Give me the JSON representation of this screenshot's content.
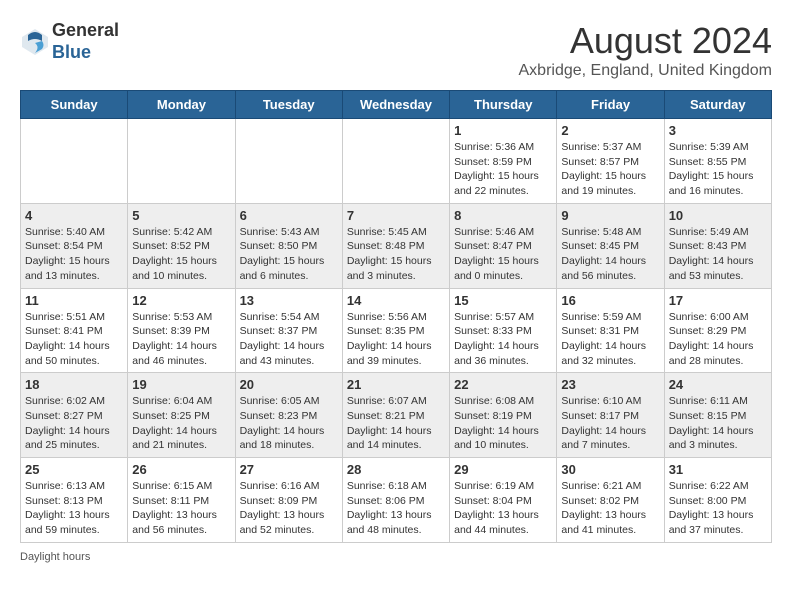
{
  "header": {
    "logo_line1": "General",
    "logo_line2": "Blue",
    "month_year": "August 2024",
    "location": "Axbridge, England, United Kingdom"
  },
  "days_of_week": [
    "Sunday",
    "Monday",
    "Tuesday",
    "Wednesday",
    "Thursday",
    "Friday",
    "Saturday"
  ],
  "weeks": [
    {
      "days": [
        {
          "num": "",
          "info": ""
        },
        {
          "num": "",
          "info": ""
        },
        {
          "num": "",
          "info": ""
        },
        {
          "num": "",
          "info": ""
        },
        {
          "num": "1",
          "info": "Sunrise: 5:36 AM\nSunset: 8:59 PM\nDaylight: 15 hours\nand 22 minutes."
        },
        {
          "num": "2",
          "info": "Sunrise: 5:37 AM\nSunset: 8:57 PM\nDaylight: 15 hours\nand 19 minutes."
        },
        {
          "num": "3",
          "info": "Sunrise: 5:39 AM\nSunset: 8:55 PM\nDaylight: 15 hours\nand 16 minutes."
        }
      ]
    },
    {
      "days": [
        {
          "num": "4",
          "info": "Sunrise: 5:40 AM\nSunset: 8:54 PM\nDaylight: 15 hours\nand 13 minutes."
        },
        {
          "num": "5",
          "info": "Sunrise: 5:42 AM\nSunset: 8:52 PM\nDaylight: 15 hours\nand 10 minutes."
        },
        {
          "num": "6",
          "info": "Sunrise: 5:43 AM\nSunset: 8:50 PM\nDaylight: 15 hours\nand 6 minutes."
        },
        {
          "num": "7",
          "info": "Sunrise: 5:45 AM\nSunset: 8:48 PM\nDaylight: 15 hours\nand 3 minutes."
        },
        {
          "num": "8",
          "info": "Sunrise: 5:46 AM\nSunset: 8:47 PM\nDaylight: 15 hours\nand 0 minutes."
        },
        {
          "num": "9",
          "info": "Sunrise: 5:48 AM\nSunset: 8:45 PM\nDaylight: 14 hours\nand 56 minutes."
        },
        {
          "num": "10",
          "info": "Sunrise: 5:49 AM\nSunset: 8:43 PM\nDaylight: 14 hours\nand 53 minutes."
        }
      ]
    },
    {
      "days": [
        {
          "num": "11",
          "info": "Sunrise: 5:51 AM\nSunset: 8:41 PM\nDaylight: 14 hours\nand 50 minutes."
        },
        {
          "num": "12",
          "info": "Sunrise: 5:53 AM\nSunset: 8:39 PM\nDaylight: 14 hours\nand 46 minutes."
        },
        {
          "num": "13",
          "info": "Sunrise: 5:54 AM\nSunset: 8:37 PM\nDaylight: 14 hours\nand 43 minutes."
        },
        {
          "num": "14",
          "info": "Sunrise: 5:56 AM\nSunset: 8:35 PM\nDaylight: 14 hours\nand 39 minutes."
        },
        {
          "num": "15",
          "info": "Sunrise: 5:57 AM\nSunset: 8:33 PM\nDaylight: 14 hours\nand 36 minutes."
        },
        {
          "num": "16",
          "info": "Sunrise: 5:59 AM\nSunset: 8:31 PM\nDaylight: 14 hours\nand 32 minutes."
        },
        {
          "num": "17",
          "info": "Sunrise: 6:00 AM\nSunset: 8:29 PM\nDaylight: 14 hours\nand 28 minutes."
        }
      ]
    },
    {
      "days": [
        {
          "num": "18",
          "info": "Sunrise: 6:02 AM\nSunset: 8:27 PM\nDaylight: 14 hours\nand 25 minutes."
        },
        {
          "num": "19",
          "info": "Sunrise: 6:04 AM\nSunset: 8:25 PM\nDaylight: 14 hours\nand 21 minutes."
        },
        {
          "num": "20",
          "info": "Sunrise: 6:05 AM\nSunset: 8:23 PM\nDaylight: 14 hours\nand 18 minutes."
        },
        {
          "num": "21",
          "info": "Sunrise: 6:07 AM\nSunset: 8:21 PM\nDaylight: 14 hours\nand 14 minutes."
        },
        {
          "num": "22",
          "info": "Sunrise: 6:08 AM\nSunset: 8:19 PM\nDaylight: 14 hours\nand 10 minutes."
        },
        {
          "num": "23",
          "info": "Sunrise: 6:10 AM\nSunset: 8:17 PM\nDaylight: 14 hours\nand 7 minutes."
        },
        {
          "num": "24",
          "info": "Sunrise: 6:11 AM\nSunset: 8:15 PM\nDaylight: 14 hours\nand 3 minutes."
        }
      ]
    },
    {
      "days": [
        {
          "num": "25",
          "info": "Sunrise: 6:13 AM\nSunset: 8:13 PM\nDaylight: 13 hours\nand 59 minutes."
        },
        {
          "num": "26",
          "info": "Sunrise: 6:15 AM\nSunset: 8:11 PM\nDaylight: 13 hours\nand 56 minutes."
        },
        {
          "num": "27",
          "info": "Sunrise: 6:16 AM\nSunset: 8:09 PM\nDaylight: 13 hours\nand 52 minutes."
        },
        {
          "num": "28",
          "info": "Sunrise: 6:18 AM\nSunset: 8:06 PM\nDaylight: 13 hours\nand 48 minutes."
        },
        {
          "num": "29",
          "info": "Sunrise: 6:19 AM\nSunset: 8:04 PM\nDaylight: 13 hours\nand 44 minutes."
        },
        {
          "num": "30",
          "info": "Sunrise: 6:21 AM\nSunset: 8:02 PM\nDaylight: 13 hours\nand 41 minutes."
        },
        {
          "num": "31",
          "info": "Sunrise: 6:22 AM\nSunset: 8:00 PM\nDaylight: 13 hours\nand 37 minutes."
        }
      ]
    }
  ],
  "footer": {
    "text": "Daylight hours"
  }
}
